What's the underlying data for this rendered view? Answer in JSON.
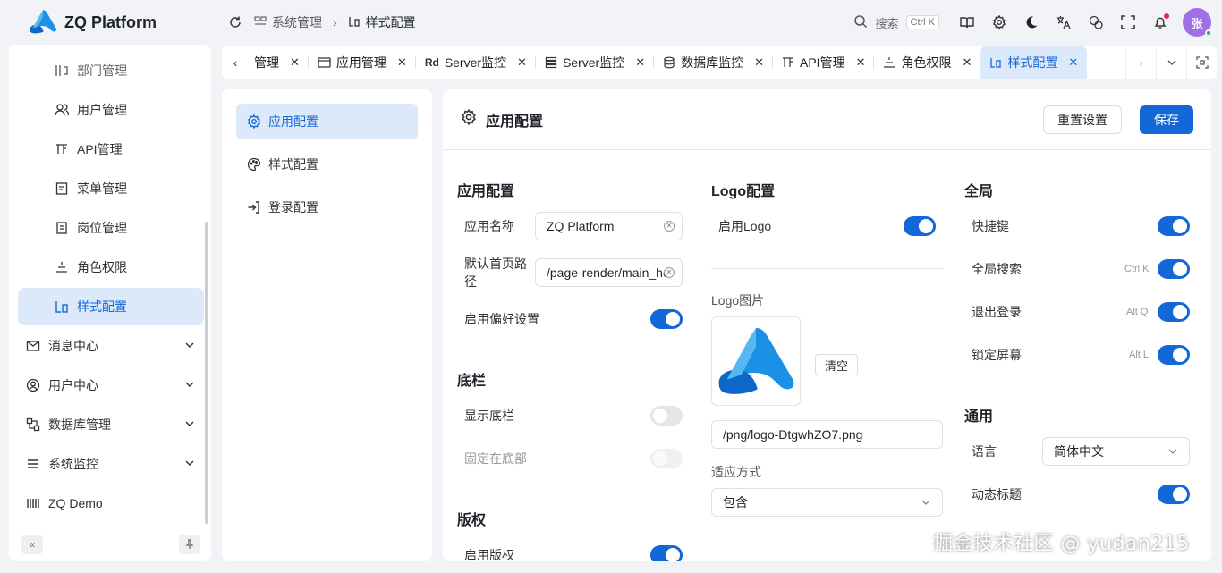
{
  "app": {
    "name": "ZQ Platform",
    "brand_color": "#1467d6"
  },
  "header": {
    "breadcrumbs": [
      {
        "label": "系统管理",
        "icon": "module-icon"
      },
      {
        "label": "样式配置",
        "icon": "style-config-icon"
      }
    ],
    "search_label": "搜索",
    "search_shortcut": "Ctrl K",
    "avatar_text": "张"
  },
  "sidebar": {
    "items": [
      {
        "label": "部门管理",
        "icon": "department-icon"
      },
      {
        "label": "用户管理",
        "icon": "users-icon"
      },
      {
        "label": "API管理",
        "icon": "api-icon"
      },
      {
        "label": "菜单管理",
        "icon": "menu-icon"
      },
      {
        "label": "岗位管理",
        "icon": "post-icon"
      },
      {
        "label": "角色权限",
        "icon": "role-icon"
      },
      {
        "label": "样式配置",
        "icon": "style-config-icon",
        "active": true
      },
      {
        "label": "消息中心",
        "icon": "mail-icon"
      },
      {
        "label": "用户中心",
        "icon": "user-circle-icon"
      },
      {
        "label": "数据库管理",
        "icon": "database-icon"
      },
      {
        "label": "系统监控",
        "icon": "list-icon"
      },
      {
        "label": "ZQ Demo",
        "icon": "barcode-icon"
      }
    ]
  },
  "tabs": [
    {
      "label": "管理"
    },
    {
      "label": "应用管理",
      "icon": "window-icon"
    },
    {
      "label": "Server监控",
      "prefix": "Rd"
    },
    {
      "label": "Server监控",
      "icon": "server-icon"
    },
    {
      "label": "数据库监控",
      "icon": "database-icon"
    },
    {
      "label": "API管理",
      "icon": "api-icon"
    },
    {
      "label": "角色权限",
      "icon": "role-icon"
    },
    {
      "label": "样式配置",
      "icon": "style-config-icon",
      "active": true
    }
  ],
  "settings_menu": [
    {
      "label": "应用配置",
      "icon": "gear-icon",
      "active": true
    },
    {
      "label": "样式配置",
      "icon": "palette-icon"
    },
    {
      "label": "登录配置",
      "icon": "login-icon"
    }
  ],
  "panel": {
    "title": "应用配置",
    "reset_label": "重置设置",
    "save_label": "保存",
    "app_section": {
      "title": "应用配置",
      "app_name_label": "应用名称",
      "app_name_value": "ZQ Platform",
      "home_path_label": "默认首页路径",
      "home_path_value": "/page-render/main_ho",
      "preference_label": "启用偏好设置",
      "preference_on": true
    },
    "footer_section": {
      "title": "底栏",
      "show_footer_label": "显示底栏",
      "show_footer_on": false,
      "fixed_bottom_label": "固定在底部",
      "fixed_bottom_on": false
    },
    "copyright_section": {
      "title": "版权",
      "enable_copyright_label": "启用版权",
      "enable_copyright_on": true
    },
    "logo_section": {
      "title": "Logo配置",
      "enable_logo_label": "启用Logo",
      "enable_logo_on": true,
      "image_label": "Logo图片",
      "clear_label": "清空",
      "image_path": "/png/logo-DtgwhZO7.png",
      "fit_label": "适应方式",
      "fit_value": "包含"
    },
    "global_section": {
      "title": "全局",
      "shortcut_label": "快捷键",
      "shortcut_on": true,
      "global_search_label": "全局搜索",
      "global_search_key": "Ctrl K",
      "global_search_on": true,
      "logout_label": "退出登录",
      "logout_key": "Alt Q",
      "logout_on": true,
      "lock_label": "锁定屏幕",
      "lock_key": "Alt L",
      "lock_on": true
    },
    "general_section": {
      "title": "通用",
      "language_label": "语言",
      "language_value": "简体中文",
      "dynamic_title_label": "动态标题",
      "dynamic_title_on": true
    }
  },
  "watermark": "掘金技术社区 @ yudan215"
}
